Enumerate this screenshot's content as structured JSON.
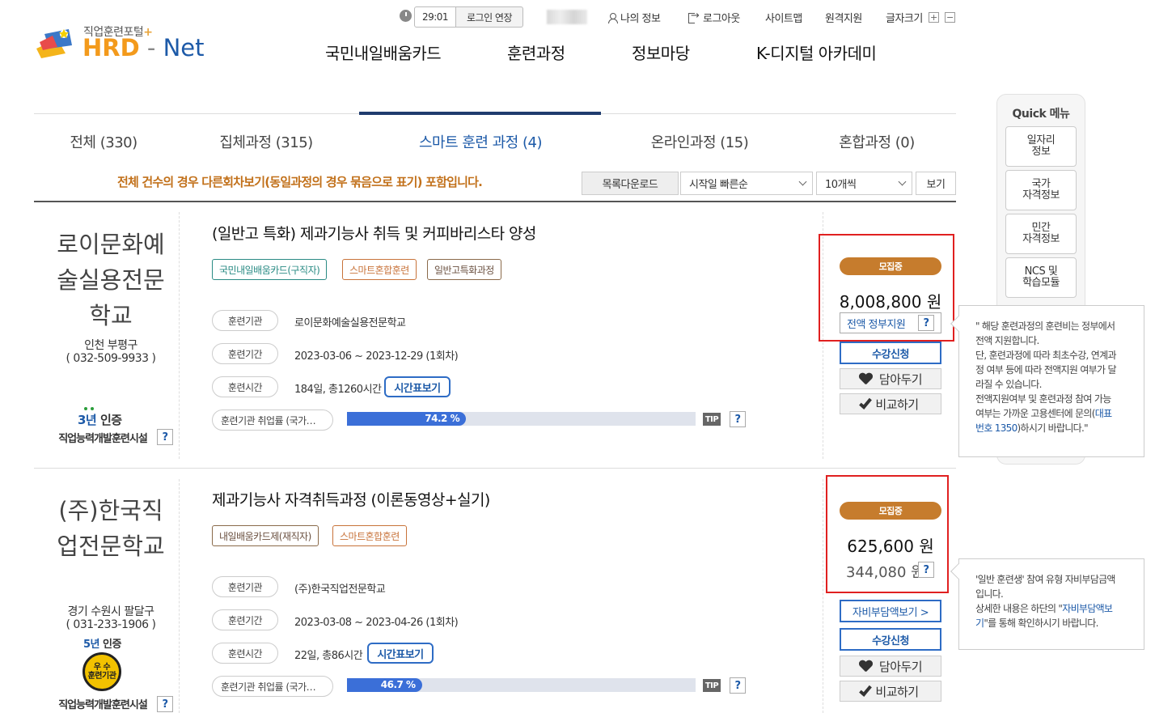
{
  "header": {
    "logo_small": "직업훈련포털",
    "logo_plus": "+",
    "logo_hrd": "HRD",
    "logo_net": "Net",
    "timer": "29:01",
    "extend_login": "로그인 연장",
    "my_info": "나의 정보",
    "logout": "로그아웃",
    "sitemap": "사이트맵",
    "remote_support": "원격지원",
    "font_size": "글자크기",
    "font_plus": "+",
    "font_minus": "−",
    "nav": [
      "국민내일배움카드",
      "훈련과정",
      "정보마당",
      "K-디지털 아카데미"
    ]
  },
  "tabs": [
    {
      "label": "전체 (330)"
    },
    {
      "label": "집체과정 (315)"
    },
    {
      "label": "스마트 훈련 과정 (4)"
    },
    {
      "label": "온라인과정 (15)"
    },
    {
      "label": "혼합과정 (0)"
    }
  ],
  "toolbar": {
    "notice": "전체 건수의 경우 다른회차보기(동일과정의 경우 묶음으로 표기) 포함입니다.",
    "download": "목록다운로드",
    "sort_selected": "시작일 빠른순",
    "page_size_selected": "10개씩",
    "view": "보기"
  },
  "courses": [
    {
      "inst_name": "로이문화예술실용전문학교",
      "inst_lines": [
        "로이문화예",
        "술실용전문",
        "학교"
      ],
      "inst_region": "인천 부평구",
      "inst_phone": "( 032-509-9933 )",
      "cert_years_num": "3년",
      "cert_years_suffix": "인증",
      "cert_label": "직업능력개발훈련시설",
      "title": "(일반고 특화) 제과기능사 취득 및 커피바리스타 양성",
      "tags": [
        "국민내일배움카드(구직자)",
        "스마트혼합훈련",
        "일반고특화과정"
      ],
      "label_inst": "훈련기관",
      "value_inst": "로이문화예술실용전문학교",
      "label_period": "훈련기간",
      "value_period": "2023-03-06 ~ 2023-12-29 (1회차)",
      "label_hours": "훈련시간",
      "value_hours": "184일, 총1260시간",
      "timetable": "시간표보기",
      "employment_label": "훈련기관 취업률 (국가…",
      "employment_rate": 74.2,
      "employment_text": "74.2 %",
      "tip": "TIP",
      "status": "모집중",
      "price": "8,008,800 원",
      "support": "전액 정부지원",
      "apply": "수강신청",
      "wish": "담아두기",
      "compare": "비교하기"
    },
    {
      "inst_name": "(주)한국직업전문학교",
      "inst_lines": [
        "(주)한국직",
        "업전문학교"
      ],
      "inst_region": "경기 수원시 팔달구",
      "inst_phone": "( 031-233-1906 )",
      "cert_years_num": "5년",
      "cert_years_suffix": "인증",
      "seal_line1": "우 수",
      "seal_line2": "훈련기관",
      "cert_label": "직업능력개발훈련시설",
      "title": "제과기능사 자격취득과정 (이론동영상+실기)",
      "tags": [
        "내일배움카드제(재직자)",
        "스마트혼합훈련"
      ],
      "label_inst": "훈련기관",
      "value_inst": "(주)한국직업전문학교",
      "label_period": "훈련기간",
      "value_period": "2023-03-08 ~ 2023-04-26 (1회차)",
      "label_hours": "훈련시간",
      "value_hours": "22일, 총86시간",
      "timetable": "시간표보기",
      "employment_label": "훈련기관 취업률 (국가…",
      "employment_rate": 46.7,
      "employment_text": "46.7 %",
      "tip": "TIP",
      "status": "모집중",
      "price": "625,600 원",
      "self_pay": "344,080 원",
      "self_pay_btn": "자비부담액보기 >",
      "apply": "수강신청",
      "wish": "담아두기",
      "compare": "비교하기"
    }
  ],
  "quick_menu": {
    "title": "Quick 메뉴",
    "items": [
      "일자리\n정보",
      "국가\n자격정보",
      "민간\n자격정보",
      "NCS 및\n학습모듈"
    ]
  },
  "tooltip1": {
    "line1": "\" 해당 훈련과정의 훈련비는 정부에서",
    "line2": "전액 지원합니다.",
    "line3": "단, 훈련과정에 따라 최초수강, 연계과",
    "line4": "정 여부 등에 따라 전액지원 여부가 달",
    "line5": "라질 수 있습니다.",
    "line6": "전액지원여부 및 훈련과정 참여 가능",
    "line7a": "여부는 가까운 고용센터에 문의(",
    "line7b": "대표",
    "line8a": "번호 1350",
    "line8b": ")하시기 바랍니다.\""
  },
  "tooltip2": {
    "line1": "'일반 훈련생' 참여 유형 자비부담금액",
    "line2": "입니다.",
    "line3a": "상세한 내용은 하단의 \"",
    "line3b": "자비부담액보",
    "line4a": "기",
    "line4b": "\"를 통해 확인하시기 바랍니다."
  },
  "question_mark": "?"
}
